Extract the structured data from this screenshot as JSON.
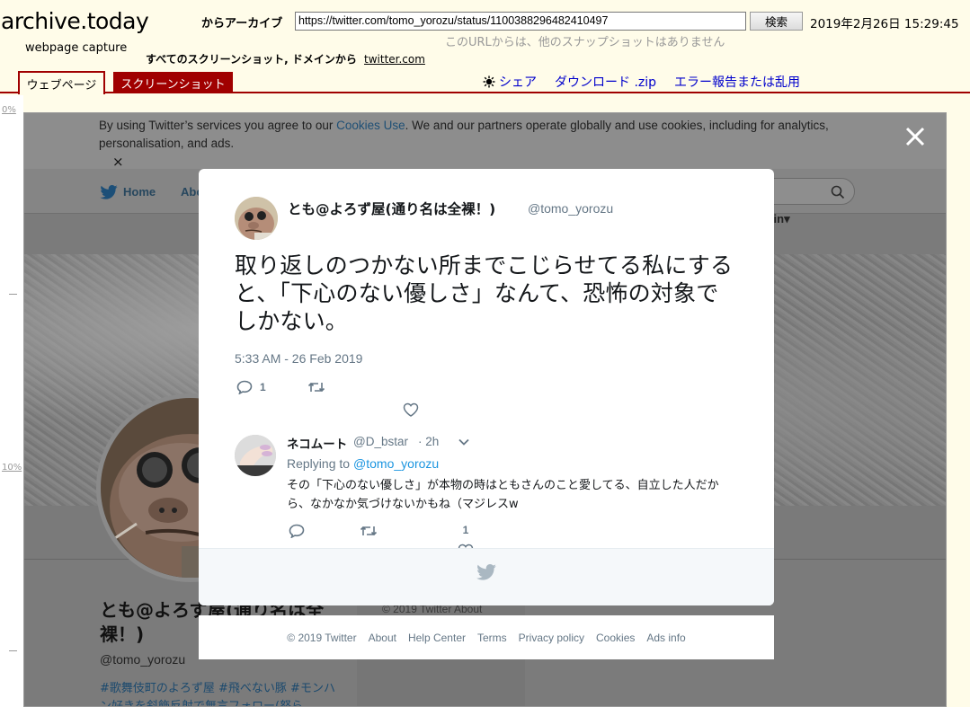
{
  "archive": {
    "logo": "archive.today",
    "logo_sub": "webpage capture",
    "from_label": "からアーカイブ",
    "url": "https://twitter.com/tomo_yorozu/status/1100388296482410497",
    "search_label": "検索",
    "timestamp": "2019年2月26日 15:29:45",
    "no_snapshots": "このURLからは、他のスナップショットはありません",
    "all_shots_label": "すべてのスクリーンショット, ドメインから",
    "all_shots_domain": "twitter.com",
    "tab_webpage": "ウェブページ",
    "tab_screenshot": "スクリーンショット",
    "share": "シェア",
    "download": "ダウンロード .zip",
    "report": "エラー報告または乱用"
  },
  "ruler": {
    "top": "0%",
    "mid": "10%"
  },
  "page": {
    "cookie_before": "By using Twitter’s services you agree to our ",
    "cookie_link": "Cookies Use",
    "cookie_after": ". We and our partners operate globally and use cookies, including for analytics, personalisation, and ads.",
    "cookie_close": "×",
    "nav_home": "Home",
    "nav_about": "Abo",
    "login": "g in",
    "profile_name": "とも@よろず屋(通り名は全裸！)",
    "profile_handle": "@tomo_yorozu",
    "profile_bio": "#歌舞伎町のよろず屋 #飛べない豚 #モンハン好きを斜飾反射で無言フォロー(怒ら",
    "copyright": "© 2019 Twitter   About"
  },
  "tweet": {
    "author_name": "とも@よろず屋(通り名は全裸！)",
    "author_handle": "@tomo_yorozu",
    "text": "取り返しのつかない所までこじらせてる私にすると、「下心のない優しさ」なんて、恐怖の対象でしかない。",
    "time": "5:33 AM - 26 Feb 2019",
    "reply_count": "1"
  },
  "reply": {
    "author_name": "ネコムート",
    "author_handle": "@D_bstar",
    "time": "· 2h",
    "replying_to_label": "Replying to",
    "replying_to": "@tomo_yorozu",
    "text": "その「下心のない優しさ」が本物の時はともさんのこと愛してる、自立した人だから、なかなか気づけないかもね（マジレスw",
    "like_count": "1"
  },
  "footer": {
    "copyright": "© 2019 Twitter",
    "about": "About",
    "help": "Help Center",
    "terms": "Terms",
    "privacy": "Privacy policy",
    "cookies": "Cookies",
    "ads": "Ads info"
  },
  "colors": {
    "archive_bg": "#fffce9",
    "archive_red": "#a00000",
    "link_blue": "#0000cc",
    "twitter_blue": "#1b95e0",
    "twitter_gray": "#657786"
  }
}
